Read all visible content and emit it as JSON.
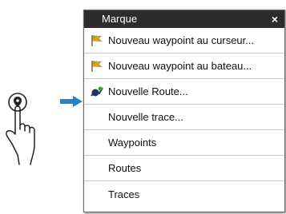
{
  "menu": {
    "title": "Marque",
    "close_symbol": "×",
    "items": [
      {
        "label": "Nouveau waypoint au curseur...",
        "icon": "flag-icon"
      },
      {
        "label": "Nouveau waypoint au bateau...",
        "icon": "flag-icon"
      },
      {
        "label": "Nouvelle Route...",
        "icon": "route-icon"
      },
      {
        "label": "Nouvelle trace...",
        "icon": ""
      },
      {
        "label": "Waypoints",
        "icon": ""
      },
      {
        "label": "Routes",
        "icon": ""
      },
      {
        "label": "Traces",
        "icon": ""
      }
    ]
  },
  "colors": {
    "header_bg": "#2c2c2c",
    "arrow": "#2f7fc4",
    "flag": "#e0a020"
  },
  "illustration": {
    "gesture": "hand-tap-icon",
    "arrow": "right-arrow-icon"
  }
}
